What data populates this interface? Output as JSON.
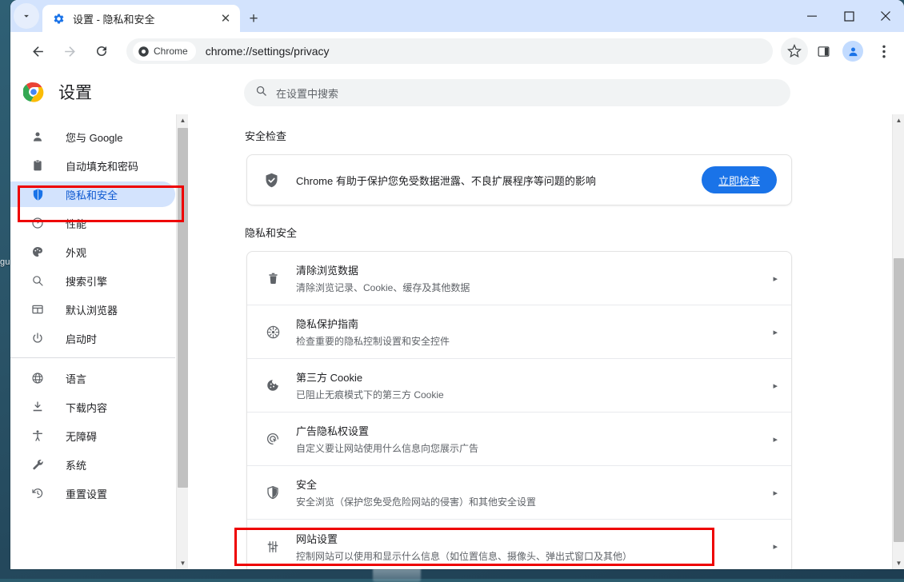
{
  "desktop": {
    "partial_label": "gu"
  },
  "browser": {
    "tab_search_icon": "chevron-down-icon",
    "tab": {
      "favicon": "gear-icon",
      "title": "设置 - 隐私和安全",
      "close_label": "✕"
    },
    "new_tab_label": "+",
    "window_controls": {
      "minimize": "—",
      "maximize": "□",
      "close": "✕"
    },
    "toolbar": {
      "back_icon": "back-arrow-icon",
      "forward_icon": "forward-arrow-icon",
      "reload_icon": "reload-icon",
      "chrome_chip_label": "Chrome",
      "url": "chrome://settings/privacy",
      "bookmark_icon": "star-icon",
      "sidepanel_icon": "side-panel-icon",
      "profile_icon": "avatar-icon",
      "menu_icon": "three-dot-menu-icon"
    }
  },
  "settings_header": {
    "logo": "chrome-logo",
    "title": "设置",
    "search_icon": "search-icon",
    "search_placeholder": "在设置中搜索",
    "search_value": ""
  },
  "sidebar": {
    "items": [
      {
        "icon": "person-icon",
        "label": "您与 Google",
        "active": false
      },
      {
        "icon": "clipboard-icon",
        "label": "自动填充和密码",
        "active": false
      },
      {
        "icon": "shield-icon",
        "label": "隐私和安全",
        "active": true
      },
      {
        "icon": "performance-icon",
        "label": "性能",
        "active": false
      },
      {
        "icon": "palette-icon",
        "label": "外观",
        "active": false
      },
      {
        "icon": "search-icon",
        "label": "搜索引擎",
        "active": false
      },
      {
        "icon": "browser-window-icon",
        "label": "默认浏览器",
        "active": false
      },
      {
        "icon": "power-icon",
        "label": "启动时",
        "active": false
      }
    ],
    "items_after_divider": [
      {
        "icon": "globe-icon",
        "label": "语言",
        "active": false
      },
      {
        "icon": "download-icon",
        "label": "下载内容",
        "active": false
      },
      {
        "icon": "accessibility-icon",
        "label": "无障碍",
        "active": false
      },
      {
        "icon": "wrench-icon",
        "label": "系统",
        "active": false
      },
      {
        "icon": "history-restore-icon",
        "label": "重置设置",
        "active": false
      }
    ]
  },
  "main": {
    "safety_check": {
      "section_title": "安全检查",
      "icon": "shield-check-icon",
      "text": "Chrome 有助于保护您免受数据泄露、不良扩展程序等问题的影响",
      "button_label": "立即检查"
    },
    "privacy": {
      "section_title": "隐私和安全",
      "rows": [
        {
          "icon": "trash-icon",
          "title": "清除浏览数据",
          "subtitle": "清除浏览记录、Cookie、缓存及其他数据",
          "chevron": "▸",
          "highlighted": false
        },
        {
          "icon": "privacy-guide-icon",
          "title": "隐私保护指南",
          "subtitle": "检查重要的隐私控制设置和安全控件",
          "chevron": "▸",
          "highlighted": false
        },
        {
          "icon": "cookie-icon",
          "title": "第三方 Cookie",
          "subtitle": "已阻止无痕模式下的第三方 Cookie",
          "chevron": "▸",
          "highlighted": false
        },
        {
          "icon": "ad-privacy-icon",
          "title": "广告隐私权设置",
          "subtitle": "自定义要让网站使用什么信息向您展示广告",
          "chevron": "▸",
          "highlighted": false
        },
        {
          "icon": "shield-icon",
          "title": "安全",
          "subtitle": "安全浏览（保护您免受危险网站的侵害）和其他安全设置",
          "chevron": "▸",
          "highlighted": false
        },
        {
          "icon": "sliders-icon",
          "title": "网站设置",
          "subtitle": "控制网站可以使用和显示什么信息（如位置信息、摄像头、弹出式窗口及其他）",
          "chevron": "▸",
          "highlighted": true
        }
      ]
    }
  },
  "scrollbars": {
    "sidebar_up": "▲",
    "sidebar_down": "▼",
    "main_up": "▲",
    "main_down": "▼"
  },
  "colors": {
    "accent_blue": "#1a73e8",
    "active_pill": "#d3e3fd",
    "active_text": "#0b57d0",
    "annotation_red": "#ee0000",
    "tabstrip": "#d3e3fd",
    "desktop": "#2a5367"
  }
}
